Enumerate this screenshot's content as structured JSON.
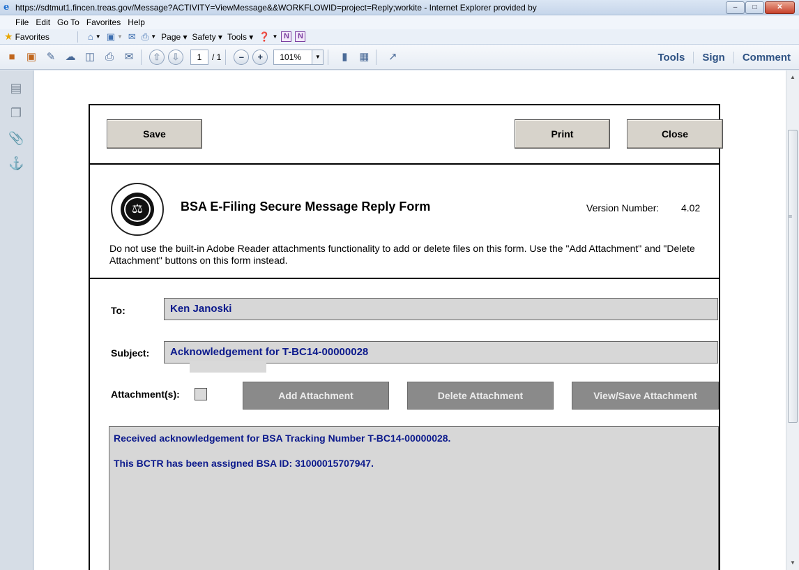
{
  "window": {
    "title": "https://sdtmut1.fincen.treas.gov/Message?ACTIVITY=ViewMessage&&WORKFLOWID=project=Reply;workite - Internet Explorer provided by"
  },
  "menu": [
    "File",
    "Edit",
    "Go To",
    "Favorites",
    "Help"
  ],
  "favorites_bar": {
    "favorites_label": "Favorites",
    "page_label": "Page ▾",
    "safety_label": "Safety ▾",
    "tools_label": "Tools ▾",
    "onenote_label": "N"
  },
  "reader_toolbar": {
    "page_current": "1",
    "page_total": "/ 1",
    "zoom": "101%",
    "links": [
      "Tools",
      "Sign",
      "Comment"
    ]
  },
  "form": {
    "buttons": {
      "save": "Save",
      "print": "Print",
      "close": "Close"
    },
    "title": "BSA E-Filing Secure Message Reply Form",
    "version_label": "Version Number:",
    "version_value": "4.02",
    "notice": "Do not use the built-in Adobe Reader attachments functionality to add or delete files on this form. Use the \"Add Attachment\" and \"Delete Attachment\" buttons on this form instead.",
    "to_label": "To:",
    "to_value": "Ken Janoski",
    "subject_label": "Subject:",
    "subject_value": "Acknowledgement for T-BC14-00000028",
    "attachments_label": "Attachment(s):",
    "add_attachment": "Add Attachment",
    "delete_attachment": "Delete Attachment",
    "view_attachment": "View/Save Attachment",
    "message_lines": [
      "Received acknowledgement for BSA Tracking Number T-BC14-00000028.",
      "This BCTR has been assigned BSA ID: 31000015707947."
    ]
  },
  "colors": {
    "field_text": "#0c1a8c",
    "button_bg": "#d7d3cb",
    "disabled_button_bg": "#8a8a8a"
  }
}
